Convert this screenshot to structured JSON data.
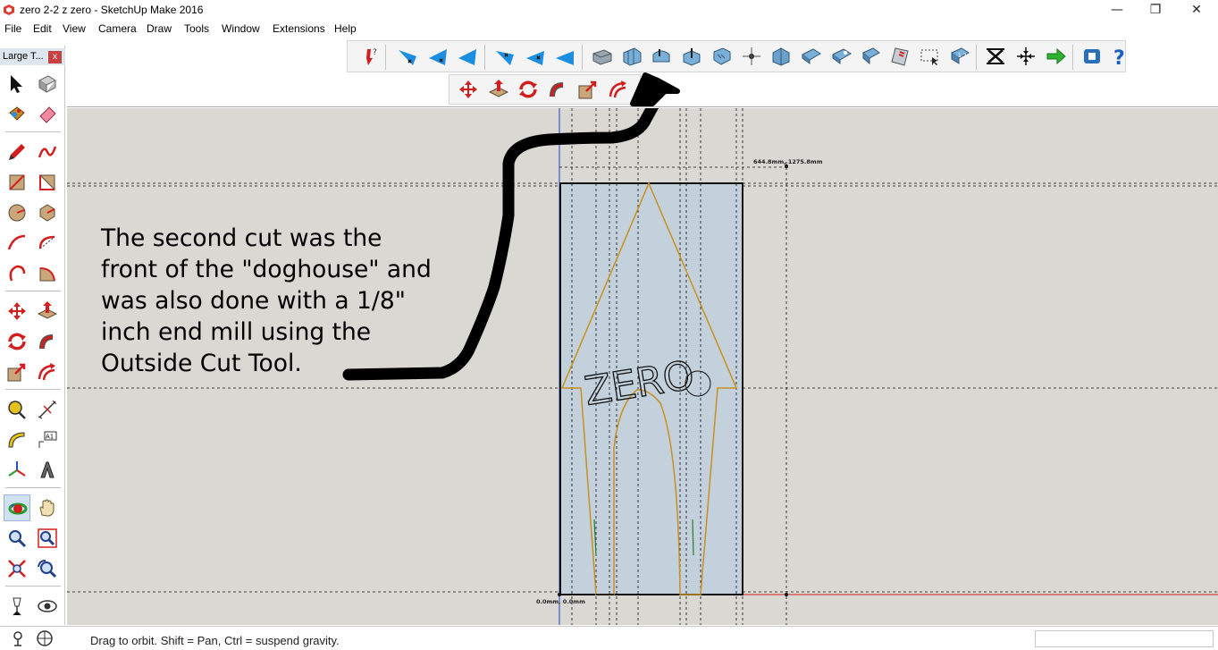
{
  "window": {
    "title": "zero 2-2 z zero - SketchUp Make 2016",
    "minimize_glyph": "—",
    "restore_glyph": "❐",
    "close_glyph": "✕"
  },
  "menu": [
    "File",
    "Edit",
    "View",
    "Camera",
    "Draw",
    "Tools",
    "Window",
    "Extensions",
    "Help"
  ],
  "toolbar": {
    "row1_icons": [
      "cam-tool-icon",
      "view-iso-x-icon",
      "view-iso-y-icon",
      "view-iso-z-icon",
      "view-top-x-icon",
      "view-top-y-icon",
      "view-top-z-icon",
      "sandbox-from-contours-icon",
      "sandbox-from-scratch-icon",
      "sandbox-smoove-icon",
      "sandbox-stamp-icon",
      "sandbox-drape-icon",
      "sandbox-add-detail-icon",
      "sandbox-flip-edge-icon",
      "dynamic-component-icon",
      "component-options-icon",
      "component-attributes-icon",
      "generate-report-icon",
      "select-box-icon",
      "layer-manager-icon",
      "delete-x-icon",
      "explode-arrows-icon",
      "export-arrow-icon",
      "extension-warehouse-icon",
      "help-icon"
    ],
    "row2_icons": [
      "move-icon",
      "push-pull-icon",
      "rotate-icon",
      "follow-me-icon",
      "scale-icon",
      "offset-icon"
    ]
  },
  "tool_panel": {
    "title": "Large T...",
    "close_glyph": "x",
    "icons": [
      "select-arrow-icon",
      "make-component-icon",
      "paint-bucket-icon",
      "eraser-icon",
      "pencil-line-icon",
      "freehand-icon",
      "rectangle-icon",
      "rotated-rectangle-icon",
      "circle-icon",
      "polygon-icon",
      "arc-icon",
      "two-point-arc-icon",
      "three-point-arc-icon",
      "pie-icon",
      "move-icon",
      "push-pull-icon",
      "rotate-icon",
      "follow-me-icon",
      "scale-icon",
      "offset-icon",
      "tape-measure-icon",
      "dimensions-icon",
      "protractor-icon",
      "text-icon",
      "axes-icon",
      "3d-text-icon",
      "orbit-icon",
      "pan-hand-icon",
      "zoom-icon",
      "zoom-window-icon",
      "zoom-extents-icon",
      "previous-view-icon",
      "position-camera-icon",
      "look-around-icon",
      "walk-icon",
      "section-plane-icon"
    ],
    "active_tool": "orbit-icon"
  },
  "viewport": {
    "annotation_lines": [
      "The second cut was the",
      "front of the \"doghouse\" and",
      "was also done with a 1/8\"",
      "inch end mill using the",
      "Outside Cut Tool."
    ],
    "top_dimension_label": "644.8mm, 1275.8mm",
    "bottom_dimension_label": "0.0mm, 0.0mm",
    "sketch_text": "ZERO",
    "background_color": "#d9d8d2",
    "board_color": "#c3d1dc",
    "outline_color": "#c8901f"
  },
  "status": {
    "message": "Drag to orbit. Shift = Pan, Ctrl = suspend gravity."
  }
}
